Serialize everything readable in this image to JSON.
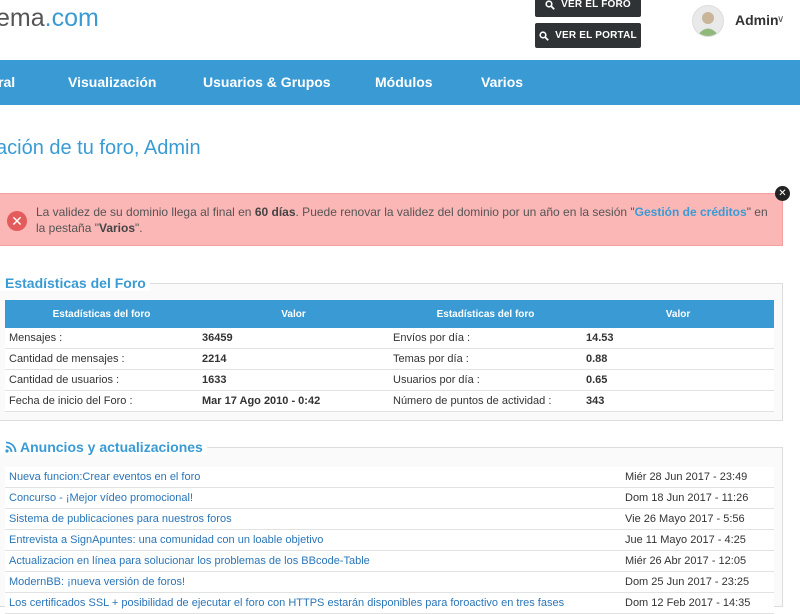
{
  "header": {
    "logo_main": "ema",
    "logo_dot": ".com",
    "btn_foro": "VER EL FORO",
    "btn_portal": "VER EL PORTAL",
    "user": "Admin"
  },
  "nav": [
    "ral",
    "Visualización",
    "Usuarios & Grupos",
    "Módulos",
    "Varios"
  ],
  "page_title": "ación de tu foro, Admin",
  "alert": {
    "t1": "La validez de su dominio llega al final en ",
    "days": "60 días",
    "t2": ". Puede renovar la validez del dominio por un año en la sesión \"",
    "link": "Gestión de créditos",
    "t3": "\" en la pestaña \"",
    "tab": "Varios",
    "t4": "\"."
  },
  "stats": {
    "title": "Estadísticas del Foro",
    "headers": [
      "Estadísticas del foro",
      "Valor",
      "Estadísticas del foro",
      "Valor"
    ],
    "rows": [
      [
        "Mensajes :",
        "36459",
        "Envíos por día :",
        "14.53"
      ],
      [
        "Cantidad de mensajes :",
        "2214",
        "Temas por día :",
        "0.88"
      ],
      [
        "Cantidad de usuarios :",
        "1633",
        "Usuarios por día :",
        "0.65"
      ],
      [
        "Fecha de inicio del Foro :",
        "Mar 17 Ago 2010 - 0:42",
        "Número de puntos de actividad :",
        "343"
      ]
    ]
  },
  "news": {
    "title": "Anuncios y actualizaciones",
    "items": [
      [
        "Nueva funcion:Crear eventos en el foro",
        "Miér 28 Jun 2017 - 23:49"
      ],
      [
        "Concurso - ¡Mejor vídeo promocional!",
        "Dom 18 Jun 2017 - 11:26"
      ],
      [
        "Sistema de publicaciones para nuestros foros",
        "Vie 26 Mayo 2017 - 5:56"
      ],
      [
        "Entrevista a SignApuntes: una comunidad con un loable objetivo",
        "Jue 11 Mayo 2017 - 4:25"
      ],
      [
        "Actualizacion en línea para solucionar los problemas de los BBcode-Table",
        "Miér 26 Abr 2017 - 12:05"
      ],
      [
        "ModernBB: ¡nueva versión de foros!",
        "Dom 25 Jun 2017 - 23:25"
      ],
      [
        "Los certificados SSL + posibilidad de ejecutar el foro con HTTPS estarán disponibles para forоactivo en tres fases",
        "Dom 12 Feb 2017 - 14:35"
      ]
    ]
  },
  "colors": {
    "accent": "#3a9bd4",
    "alert_bg": "#fbb6b6",
    "dark_button": "#2f3336"
  }
}
